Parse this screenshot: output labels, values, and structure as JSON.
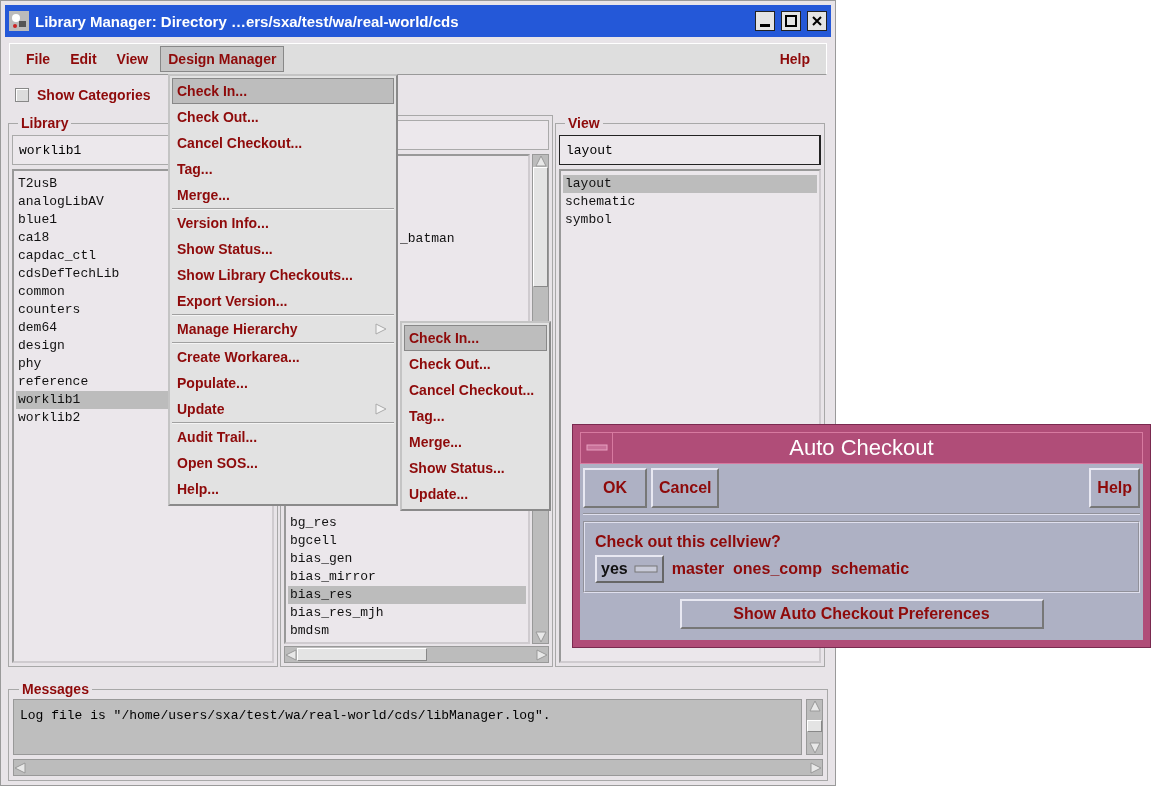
{
  "window": {
    "title": "Library Manager: Directory …ers/sxa/test/wa/real-world/cds"
  },
  "menubar": {
    "left": [
      {
        "label": "File",
        "selected": false
      },
      {
        "label": "Edit",
        "selected": false
      },
      {
        "label": "View",
        "selected": false
      },
      {
        "label": "Design Manager",
        "selected": true
      }
    ],
    "right": [
      {
        "label": "Help",
        "selected": false
      }
    ]
  },
  "show_categories": {
    "label": "Show Categories",
    "checked": false
  },
  "library": {
    "title": "Library",
    "value": "worklib1",
    "items": [
      {
        "text": "T2usB",
        "selected": false
      },
      {
        "text": "analogLibAV",
        "selected": false
      },
      {
        "text": "blue1",
        "selected": false
      },
      {
        "text": "ca18",
        "selected": false
      },
      {
        "text": "capdac_ctl",
        "selected": false
      },
      {
        "text": "cdsDefTechLib",
        "selected": false
      },
      {
        "text": "common",
        "selected": false
      },
      {
        "text": "counters",
        "selected": false
      },
      {
        "text": "dem64",
        "selected": false
      },
      {
        "text": "design",
        "selected": false
      },
      {
        "text": "phy",
        "selected": false
      },
      {
        "text": "reference",
        "selected": false
      },
      {
        "text": "worklib1",
        "selected": true
      },
      {
        "text": "worklib2",
        "selected": false
      }
    ]
  },
  "cell": {
    "items_upper": [
      {
        "text": "_batman",
        "selected": false
      }
    ],
    "items_lower": [
      {
        "text": "bg_res",
        "selected": false
      },
      {
        "text": "bgcell",
        "selected": false
      },
      {
        "text": "bias_gen",
        "selected": false
      },
      {
        "text": "bias_mirror",
        "selected": false
      },
      {
        "text": "bias_res",
        "selected": true
      },
      {
        "text": "bias_res_mjh",
        "selected": false
      },
      {
        "text": "bmdsm",
        "selected": false
      }
    ]
  },
  "view": {
    "title": "View",
    "value": "layout",
    "items": [
      {
        "text": "layout",
        "selected": true
      },
      {
        "text": "schematic",
        "selected": false
      },
      {
        "text": "symbol",
        "selected": false
      }
    ]
  },
  "menu": {
    "sections": [
      {
        "items": [
          {
            "label": "Check In...",
            "selected": true,
            "has_submenu": false
          },
          {
            "label": "Check Out...",
            "selected": false,
            "has_submenu": false
          },
          {
            "label": "Cancel Checkout...",
            "selected": false,
            "has_submenu": false
          },
          {
            "label": "Tag...",
            "selected": false,
            "has_submenu": false
          },
          {
            "label": "Merge...",
            "selected": false,
            "has_submenu": false
          }
        ]
      },
      {
        "items": [
          {
            "label": "Version Info...",
            "selected": false,
            "has_submenu": false
          },
          {
            "label": "Show Status...",
            "selected": false,
            "has_submenu": false
          },
          {
            "label": "Show Library Checkouts...",
            "selected": false,
            "has_submenu": false
          },
          {
            "label": "Export Version...",
            "selected": false,
            "has_submenu": false
          }
        ]
      },
      {
        "items": [
          {
            "label": "Manage Hierarchy",
            "selected": false,
            "has_submenu": true
          }
        ]
      },
      {
        "items": [
          {
            "label": "Create Workarea...",
            "selected": false,
            "has_submenu": false
          },
          {
            "label": "Populate...",
            "selected": false,
            "has_submenu": false
          },
          {
            "label": "Update",
            "selected": false,
            "has_submenu": true
          }
        ]
      },
      {
        "items": [
          {
            "label": "Audit Trail...",
            "selected": false,
            "has_submenu": false
          },
          {
            "label": "Open SOS...",
            "selected": false,
            "has_submenu": false
          },
          {
            "label": "Help...",
            "selected": false,
            "has_submenu": false
          }
        ]
      }
    ]
  },
  "submenu": {
    "items": [
      {
        "label": "Check In...",
        "selected": true
      },
      {
        "label": "Check Out...",
        "selected": false
      },
      {
        "label": "Cancel Checkout...",
        "selected": false
      },
      {
        "label": "Tag...",
        "selected": false
      },
      {
        "label": "Merge...",
        "selected": false
      },
      {
        "label": "Show Status...",
        "selected": false
      },
      {
        "label": "Update...",
        "selected": false
      }
    ]
  },
  "messages": {
    "title": "Messages",
    "text": "Log file is \"/home/users/sxa/test/wa/real-world/cds/libManager.log\"."
  },
  "dialog": {
    "title": "Auto Checkout",
    "buttons_left": [
      "OK",
      "Cancel"
    ],
    "button_right": "Help",
    "question": "Check out this cellview?",
    "choice": "yes",
    "details": "master  ones_comp  schematic",
    "preferences_button": "Show Auto Checkout Preferences"
  }
}
